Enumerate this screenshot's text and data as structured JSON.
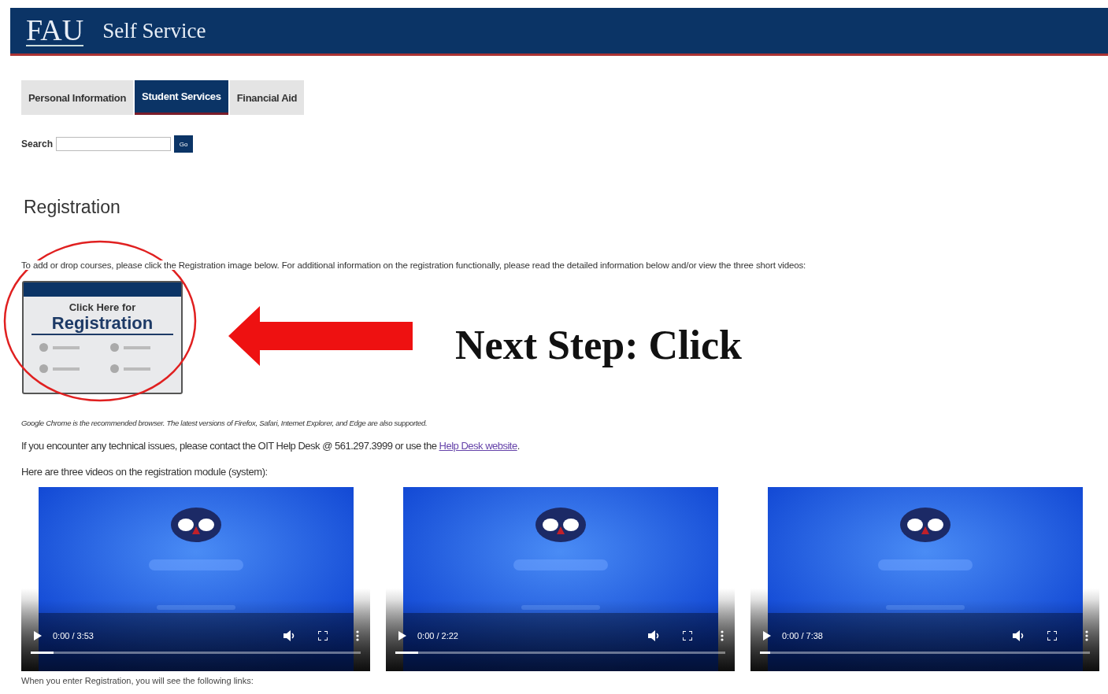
{
  "header": {
    "logo": "FAU",
    "title": "Self Service"
  },
  "tabs": [
    {
      "label": "Personal Information",
      "selected": false
    },
    {
      "label": "Student Services",
      "selected": true
    },
    {
      "label": "Financial Aid",
      "selected": false
    }
  ],
  "search": {
    "label": "Search",
    "button": "Go"
  },
  "heading": "Registration",
  "intro": "To add or drop courses, please click the Registration image below. For additional information on the registration functionally, please read the detailed information below and/or view the three short videos:",
  "registration_tile": {
    "line_1": "Click Here for",
    "line_2": "Registration"
  },
  "annotation": {
    "text": "Next Step: Click"
  },
  "browser_note": "Google Chrome is the recommended browser. The latest versions of Firefox, Safari, Internet Explorer, and Edge are also supported.",
  "help": {
    "text": "If you encounter any technical issues, please contact the OIT Help Desk @ 561.297.3999 or use the",
    "link": "Help Desk website",
    "end": "."
  },
  "videos_intro": "Here are three videos on the registration module (system):",
  "videos": [
    {
      "kind": "picture",
      "time": "0:00 / 3:53",
      "level": 0.07
    },
    {
      "kind": "picture",
      "time": "0:00 / 2:22",
      "level": 0.07
    },
    {
      "kind": "picture",
      "time": "0:00 / 7:38",
      "level": 0.03
    }
  ],
  "footer_text": "When you enter Registration, you will see the following links:"
}
